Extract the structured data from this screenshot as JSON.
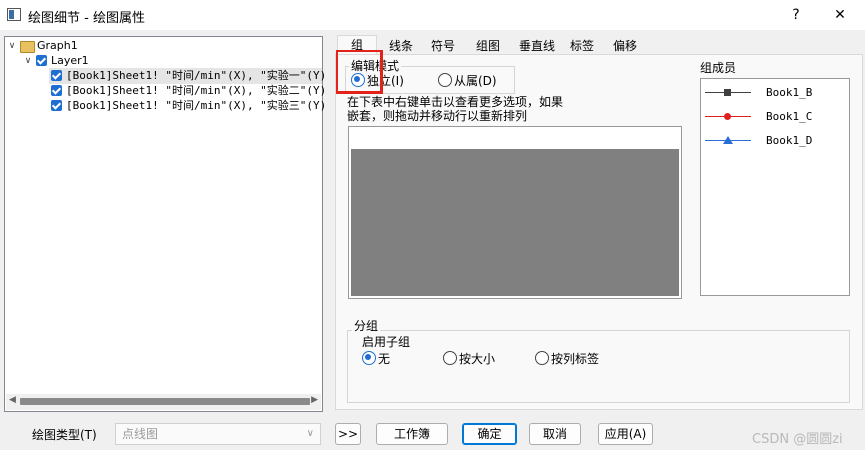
{
  "window": {
    "title": "绘图细节 - 绘图属性",
    "help_label": "?",
    "close_label": "✕"
  },
  "tree": {
    "root_label": "Graph1",
    "layer_label": "Layer1",
    "rows": [
      {
        "label": "[Book1]Sheet1! \"时间/min\"(X), \"实验一\"(Y) ["
      },
      {
        "label": "[Book1]Sheet1! \"时间/min\"(X), \"实验二\"(Y) ["
      },
      {
        "label": "[Book1]Sheet1! \"时间/min\"(X), \"实验三\"(Y) ["
      }
    ]
  },
  "tabs": [
    {
      "label": "组"
    },
    {
      "label": "线条"
    },
    {
      "label": "符号"
    },
    {
      "label": "组图"
    },
    {
      "label": "垂直线"
    },
    {
      "label": "标签"
    },
    {
      "label": "偏移"
    }
  ],
  "edit_mode": {
    "title": "编辑模式",
    "options": [
      {
        "label": "独立(I)",
        "selected": true
      },
      {
        "label": "从属(D)",
        "selected": false
      }
    ]
  },
  "hint_text_1": "在下表中右键单击以查看更多选项，如果",
  "hint_text_2": "嵌套，则拖动并移动行以重新排列",
  "members": {
    "title": "组成员",
    "items": [
      {
        "label": "Book1_B",
        "color": "#404040",
        "marker": "square"
      },
      {
        "label": "Book1_C",
        "color": "#e02020",
        "marker": "circle"
      },
      {
        "label": "Book1_D",
        "color": "#2a6fd6",
        "marker": "triangle"
      }
    ]
  },
  "grouping": {
    "title": "分组",
    "subgroup_label": "启用子组",
    "options": [
      {
        "label": "无",
        "selected": true
      },
      {
        "label": "按大小",
        "selected": false
      },
      {
        "label": "按列标签",
        "selected": false
      }
    ]
  },
  "footer": {
    "plot_type_label": "绘图类型(T)",
    "plot_type_value": "点线图",
    "expand_label": ">>",
    "workbook_label": "工作簿",
    "ok_label": "确定",
    "cancel_label": "取消",
    "apply_label": "应用(A)"
  },
  "watermark": "CSDN @圆圆zi"
}
